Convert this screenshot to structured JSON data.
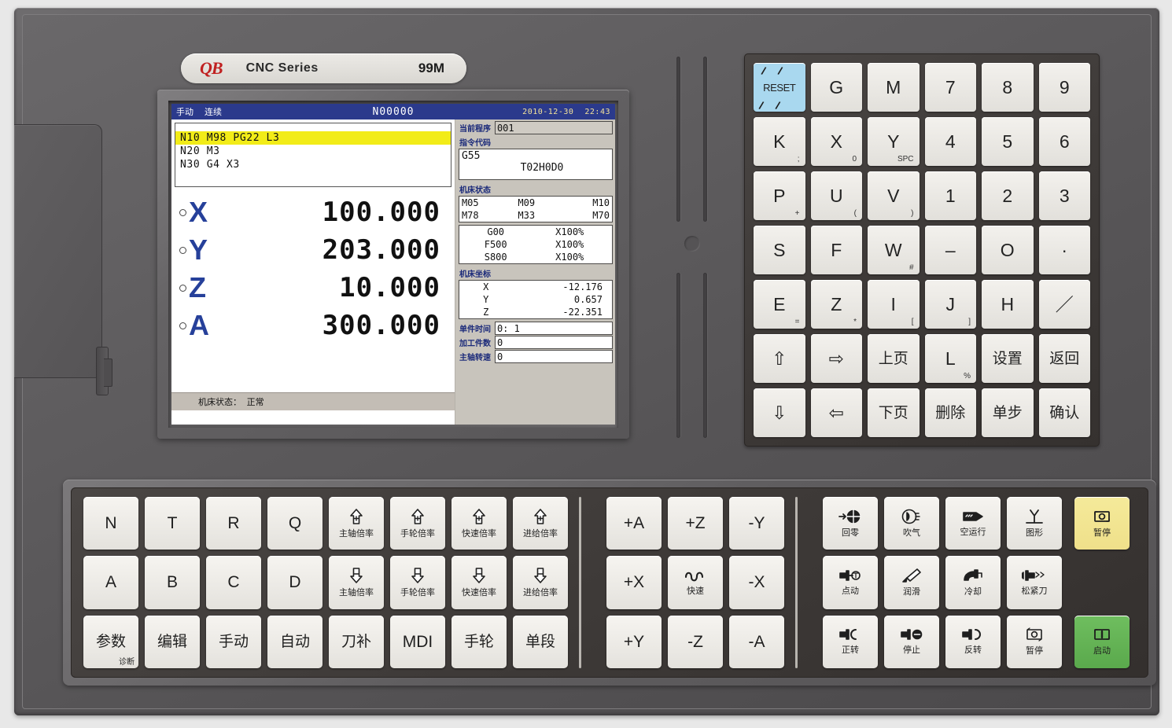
{
  "brand": {
    "logo": "QB",
    "series": "CNC Series",
    "model": "99M"
  },
  "screen": {
    "titlebar": {
      "mode": "手动",
      "submode": "连续",
      "block_number": "N00000",
      "date": "2010-12-30",
      "time": "22:43"
    },
    "program_lines": [
      {
        "text": "N10 M98 PG22 L3",
        "highlighted": true
      },
      {
        "text": "N20 M3",
        "highlighted": false
      },
      {
        "text": "N30 G4 X3",
        "highlighted": false
      }
    ],
    "axes": [
      {
        "name": "X",
        "value": "100.000"
      },
      {
        "name": "Y",
        "value": "203.000"
      },
      {
        "name": "Z",
        "value": "10.000"
      },
      {
        "name": "A",
        "value": "300.000"
      }
    ],
    "machine_status_line": "机床状态： 正常",
    "current_program": {
      "label": "当前程序",
      "value": "001"
    },
    "command_code": {
      "label": "指令代码",
      "line1": "G55",
      "line2": "T02H0D0"
    },
    "machine_state": {
      "label": "机床状态",
      "rows": [
        [
          "M05",
          "M09",
          "M10"
        ],
        [
          "M78",
          "M33",
          "M70"
        ]
      ]
    },
    "overrides": [
      {
        "code": "G00",
        "pct": "X100%"
      },
      {
        "code": "F500",
        "pct": "X100%"
      },
      {
        "code": "S800",
        "pct": "X100%"
      }
    ],
    "machine_coords": {
      "label": "机床坐标",
      "rows": [
        {
          "axis": "X",
          "value": "-12.176"
        },
        {
          "axis": "Y",
          "value": "0.657"
        },
        {
          "axis": "Z",
          "value": "-22.351"
        }
      ]
    },
    "counters": [
      {
        "label": "单件时间",
        "value": "0: 1"
      },
      {
        "label": "加工件数",
        "value": "0"
      },
      {
        "label": "主轴转速",
        "value": "0"
      }
    ]
  },
  "keypad_right": [
    {
      "name": "reset-key",
      "main": "RESET",
      "sub": "",
      "style": "reset"
    },
    {
      "name": "g-key",
      "main": "G",
      "sub": ""
    },
    {
      "name": "m-key",
      "main": "M",
      "sub": ""
    },
    {
      "name": "num-7-key",
      "main": "7",
      "sub": ""
    },
    {
      "name": "num-8-key",
      "main": "8",
      "sub": ""
    },
    {
      "name": "num-9-key",
      "main": "9",
      "sub": ""
    },
    {
      "name": "k-key",
      "main": "K",
      "sub": ";"
    },
    {
      "name": "x-key",
      "main": "X",
      "sub": "0"
    },
    {
      "name": "y-key",
      "main": "Y",
      "sub": "SPC"
    },
    {
      "name": "num-4-key",
      "main": "4",
      "sub": ""
    },
    {
      "name": "num-5-key",
      "main": "5",
      "sub": ""
    },
    {
      "name": "num-6-key",
      "main": "6",
      "sub": ""
    },
    {
      "name": "p-key",
      "main": "P",
      "sub": "+"
    },
    {
      "name": "u-key",
      "main": "U",
      "sub": "("
    },
    {
      "name": "v-key",
      "main": "V",
      "sub": ")"
    },
    {
      "name": "num-1-key",
      "main": "1",
      "sub": ""
    },
    {
      "name": "num-2-key",
      "main": "2",
      "sub": ""
    },
    {
      "name": "num-3-key",
      "main": "3",
      "sub": ""
    },
    {
      "name": "s-key",
      "main": "S",
      "sub": ""
    },
    {
      "name": "f-key",
      "main": "F",
      "sub": ""
    },
    {
      "name": "w-key",
      "main": "W",
      "sub": "#"
    },
    {
      "name": "minus-key",
      "main": "–",
      "sub": ""
    },
    {
      "name": "num-0-key",
      "main": "O",
      "sub": ""
    },
    {
      "name": "decimal-point-key",
      "main": "·",
      "sub": ""
    },
    {
      "name": "e-key",
      "main": "E",
      "sub": "="
    },
    {
      "name": "z-key",
      "main": "Z",
      "sub": "*"
    },
    {
      "name": "i-key",
      "main": "I",
      "sub": "["
    },
    {
      "name": "j-key",
      "main": "J",
      "sub": "]"
    },
    {
      "name": "h-key",
      "main": "H",
      "sub": ""
    },
    {
      "name": "slash-key",
      "main": "／",
      "sub": ""
    },
    {
      "name": "arrow-up-key",
      "main": "⇧",
      "sub": "",
      "style": "arrow"
    },
    {
      "name": "arrow-right-key",
      "main": "⇨",
      "sub": "",
      "style": "arrow"
    },
    {
      "name": "page-up-key",
      "main": "上页",
      "sub": "",
      "style": "cjk"
    },
    {
      "name": "l-key",
      "main": "L",
      "sub": "%"
    },
    {
      "name": "settings-key",
      "main": "设置",
      "sub": "",
      "style": "cjk"
    },
    {
      "name": "return-key",
      "main": "返回",
      "sub": "",
      "style": "cjk"
    },
    {
      "name": "arrow-down-key",
      "main": "⇩",
      "sub": "",
      "style": "arrow"
    },
    {
      "name": "arrow-left-key",
      "main": "⇦",
      "sub": "",
      "style": "arrow"
    },
    {
      "name": "page-down-key",
      "main": "下页",
      "sub": "",
      "style": "cjk"
    },
    {
      "name": "delete-key",
      "main": "删除",
      "sub": "",
      "style": "cjk"
    },
    {
      "name": "single-step-key",
      "main": "单步",
      "sub": "",
      "style": "cjk"
    },
    {
      "name": "confirm-key",
      "main": "确认",
      "sub": "",
      "style": "cjk"
    }
  ],
  "bottom_alpha": [
    {
      "name": "n-key",
      "label": "N"
    },
    {
      "name": "t-key",
      "label": "T"
    },
    {
      "name": "r-key",
      "label": "R"
    },
    {
      "name": "q-key",
      "label": "Q"
    },
    {
      "name": "spindle-override-up-key",
      "label": "主轴倍率",
      "icon": "arrow-up-plus-icon",
      "cjk": true
    },
    {
      "name": "handwheel-override-up-key",
      "label": "手轮倍率",
      "icon": "arrow-up-plus-icon",
      "cjk": true
    },
    {
      "name": "rapid-override-up-key",
      "label": "快速倍率",
      "icon": "arrow-up-plus-icon",
      "cjk": true
    },
    {
      "name": "feed-override-up-key",
      "label": "进给倍率",
      "icon": "arrow-up-plus-icon",
      "cjk": true
    },
    {
      "name": "a-key",
      "label": "A"
    },
    {
      "name": "b-key",
      "label": "B"
    },
    {
      "name": "c-key",
      "label": "C"
    },
    {
      "name": "d-key",
      "label": "D"
    },
    {
      "name": "spindle-override-down-key",
      "label": "主轴倍率",
      "icon": "arrow-down-minus-icon",
      "cjk": true
    },
    {
      "name": "handwheel-override-down-key",
      "label": "手轮倍率",
      "icon": "arrow-down-minus-icon",
      "cjk": true
    },
    {
      "name": "rapid-override-down-key",
      "label": "快速倍率",
      "icon": "arrow-down-minus-icon",
      "cjk": true
    },
    {
      "name": "feed-override-down-key",
      "label": "进给倍率",
      "icon": "arrow-down-minus-icon",
      "cjk": true
    },
    {
      "name": "parameter-key",
      "label": "参数",
      "sub": "诊断",
      "cjk": true
    },
    {
      "name": "edit-key",
      "label": "编辑",
      "cjk": true
    },
    {
      "name": "manual-key",
      "label": "手动",
      "cjk": true
    },
    {
      "name": "auto-key",
      "label": "自动",
      "cjk": true
    },
    {
      "name": "tool-comp-key",
      "label": "刀补",
      "cjk": true
    },
    {
      "name": "mdi-key",
      "label": "MDI"
    },
    {
      "name": "handwheel-key",
      "label": "手轮",
      "cjk": true
    },
    {
      "name": "single-block-key",
      "label": "单段",
      "cjk": true
    }
  ],
  "bottom_jog": [
    {
      "name": "jog-a-plus-key",
      "label": "+A"
    },
    {
      "name": "jog-z-plus-key",
      "label": "+Z"
    },
    {
      "name": "jog-y-minus-key",
      "label": "-Y"
    },
    {
      "name": "jog-x-plus-key",
      "label": "+X"
    },
    {
      "name": "rapid-key",
      "label": "快速",
      "icon": "squiggle-icon",
      "cjk": true
    },
    {
      "name": "jog-x-minus-key",
      "label": "-X"
    },
    {
      "name": "jog-y-plus-key",
      "label": "+Y"
    },
    {
      "name": "jog-z-minus-key",
      "label": "-Z"
    },
    {
      "name": "jog-a-minus-key",
      "label": "-A"
    }
  ],
  "bottom_func": [
    {
      "name": "return-zero-key",
      "label": "回零",
      "icon": "home-target-icon"
    },
    {
      "name": "air-blow-key",
      "label": "吹气",
      "icon": "air-blow-icon"
    },
    {
      "name": "dry-run-key",
      "label": "空运行",
      "icon": "dry-run-icon"
    },
    {
      "name": "graphics-key",
      "label": "图形",
      "icon": "graphics-icon"
    },
    {
      "name": "jog-key",
      "label": "点动",
      "icon": "spindle-jog-icon"
    },
    {
      "name": "lubrication-key",
      "label": "润滑",
      "icon": "oil-nozzle-icon"
    },
    {
      "name": "coolant-key",
      "label": "冷却",
      "icon": "coolant-tap-icon"
    },
    {
      "name": "tool-clamp-key",
      "label": "松紧刀",
      "icon": "tool-clamp-icon"
    },
    {
      "name": "spindle-forward-key",
      "label": "正转",
      "icon": "spindle-cw-icon"
    },
    {
      "name": "spindle-stop-key",
      "label": "停止",
      "icon": "spindle-stop-icon"
    },
    {
      "name": "spindle-reverse-key",
      "label": "反转",
      "icon": "spindle-ccw-icon"
    },
    {
      "name": "spindle-pause-key",
      "label": "暂停",
      "icon": "cycle-pause-icon"
    }
  ],
  "bottom_startstop": [
    {
      "name": "feed-hold-key",
      "label": "暂停",
      "icon": "cycle-hold-icon",
      "color": "#f0e68c",
      "style": "yellow"
    },
    {
      "name": "cycle-start-key",
      "label": "启动",
      "icon": "cycle-start-icon",
      "color": "#5aa94c",
      "style": "green"
    }
  ],
  "colors": {
    "titlebar_blue": "#2b3a8c",
    "highlight_yellow": "#f2ec18",
    "axis_blue": "#26409a",
    "reset_blue": "#a9d8ef",
    "pause_yellow": "#f0e68c",
    "start_green": "#5aa94c"
  }
}
